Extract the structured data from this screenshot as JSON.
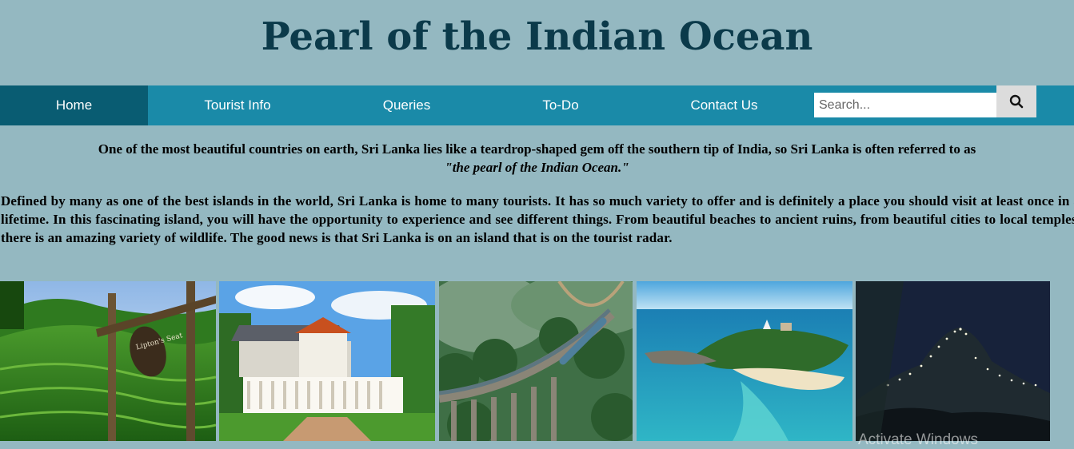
{
  "header": {
    "title": "Pearl of the Indian Ocean"
  },
  "nav": {
    "items": [
      {
        "label": "Home",
        "active": true
      },
      {
        "label": "Tourist Info",
        "active": false
      },
      {
        "label": "Queries",
        "active": false
      },
      {
        "label": "To-Do",
        "active": false
      },
      {
        "label": "Contact Us",
        "active": false
      }
    ],
    "search": {
      "placeholder": "Search...",
      "value": "",
      "icon": "search-icon"
    }
  },
  "content": {
    "intro_text": "One of the most beautiful countries on earth, Sri Lanka lies like a teardrop-shaped gem off the southern tip of India, so Sri Lanka is often referred to as",
    "intro_quote": "\"the pearl of the Indian Ocean.\"",
    "description": "Defined by many as one of the best islands in the world, Sri Lanka is home to many tourists. It has so much variety to offer and is definitely a place you should visit at least once in a lifetime. In this fascinating island, you will have the opportunity to experience and see different things. From beautiful beaches to ancient ruins, from beautiful cities to local temples, there is an amazing variety of wildlife. The good news is that Sri Lanka is on an island that is on the tourist radar."
  },
  "gallery": {
    "photos": [
      {
        "name": "liptons-seat-photo",
        "sign_text": "Lipton's Seat"
      },
      {
        "name": "temple-of-tooth-photo"
      },
      {
        "name": "nine-arch-bridge-photo"
      },
      {
        "name": "coastal-island-photo"
      },
      {
        "name": "adams-peak-night-photo"
      }
    ]
  },
  "overlay": {
    "watermark": "Activate Windows"
  },
  "colors": {
    "page_bg": "#94b8c1",
    "nav_bg": "#1a8aa8",
    "nav_active_bg": "#095c72",
    "title_color": "#0b3a4a"
  }
}
